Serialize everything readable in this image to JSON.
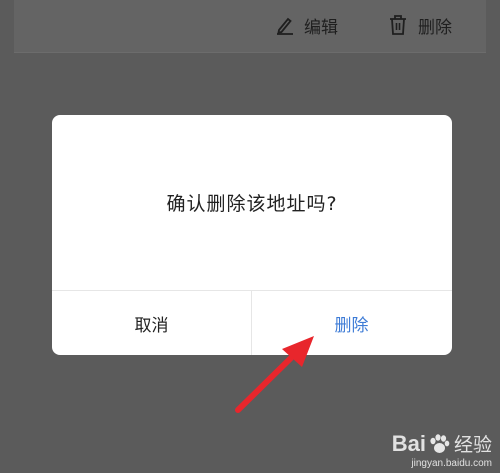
{
  "background_card": {
    "edit_label": "编辑",
    "delete_label": "删除"
  },
  "dialog": {
    "message": "确认删除该地址吗?",
    "cancel_label": "取消",
    "confirm_label": "删除"
  },
  "colors": {
    "overlay": "#5b5b5b",
    "confirm_text": "#3d7bd6",
    "arrow": "#e8262c"
  },
  "watermark": {
    "logo_text_left": "Bai",
    "logo_text_right": "经验",
    "url": "jingyan.baidu.com"
  }
}
